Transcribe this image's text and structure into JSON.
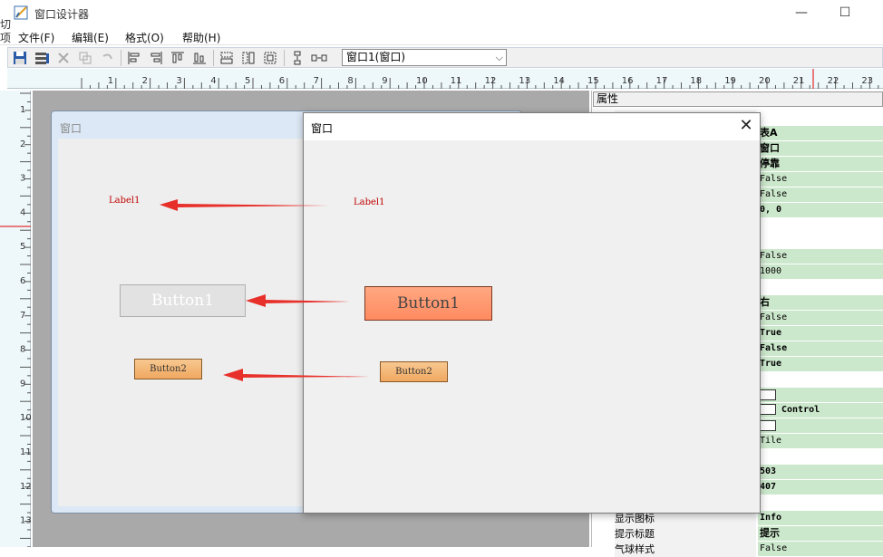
{
  "app": {
    "title": "窗口设计器",
    "icon": "designer-app-icon"
  },
  "window_controls": {
    "minimize": "—",
    "maximize": "☐"
  },
  "menu": [
    {
      "label": "文件(F)"
    },
    {
      "label": "编辑(E)"
    },
    {
      "label": "格式(O)"
    },
    {
      "label": "帮助(H)"
    }
  ],
  "toolbar": {
    "buttons": [
      "save-icon",
      "multi-save-icon",
      "delete-icon",
      "copy-icon",
      "undo-icon",
      "align-left-icon",
      "align-right-icon",
      "align-top-icon",
      "align-bottom-icon",
      "same-width-icon",
      "same-height-icon",
      "same-size-icon",
      "vertical-spacing-icon",
      "horizontal-spacing-icon"
    ],
    "combo_value": "窗口1(窗口)"
  },
  "rulers": {
    "horizontal": [
      "1",
      "2",
      "3",
      "4",
      "5",
      "6",
      "7",
      "8",
      "9",
      "10",
      "11",
      "12",
      "13",
      "14",
      "15",
      "16",
      "17",
      "18",
      "19",
      "20",
      "21",
      "22",
      "23"
    ],
    "vertical": [
      "1",
      "2",
      "3",
      "4",
      "5",
      "6",
      "7",
      "8",
      "9",
      "10",
      "11",
      "12",
      "13"
    ],
    "left_edge_glyphs": [
      "切",
      "项"
    ]
  },
  "design_form": {
    "title": "窗口",
    "label1": "Label1",
    "button1": "Button1",
    "button2": "Button2"
  },
  "preview": {
    "title": "窗口",
    "close": "✕",
    "label1": "Label1",
    "button1": "Button1",
    "button2": "Button2"
  },
  "properties": {
    "header": "属性",
    "rows": [
      {
        "name": "",
        "value": ""
      },
      {
        "name": "",
        "value": "表A"
      },
      {
        "name": "",
        "value": "窗口"
      },
      {
        "name": "",
        "value": "停靠"
      },
      {
        "name": "",
        "value": "False"
      },
      {
        "name": "",
        "value": "False"
      },
      {
        "name": "",
        "value": "0, 0"
      },
      {
        "name": "",
        "value": ""
      },
      {
        "name": "",
        "value": ""
      },
      {
        "name": "",
        "value": "False"
      },
      {
        "name": "",
        "value": "1000"
      },
      {
        "name": "",
        "value": ""
      },
      {
        "name": "",
        "value": "右"
      },
      {
        "name": "",
        "value": "False"
      },
      {
        "name": "",
        "value": "True"
      },
      {
        "name": "",
        "value": "False"
      },
      {
        "name": "",
        "value": "True"
      },
      {
        "name": "",
        "value": ""
      },
      {
        "name": "",
        "value": ""
      },
      {
        "name": "",
        "value": "Control"
      },
      {
        "name": "",
        "value": ""
      },
      {
        "name": "",
        "value": "Tile"
      },
      {
        "name": "",
        "value": ""
      },
      {
        "name": "",
        "value": "503"
      },
      {
        "name": "",
        "value": "407"
      },
      {
        "name": "",
        "value": ""
      },
      {
        "name": "显示图标",
        "value": "Info"
      },
      {
        "name": "提示标题",
        "value": "提示"
      },
      {
        "name": "气球样式",
        "value": "False"
      }
    ]
  },
  "colors": {
    "label_red": "#c00000",
    "arrow_red": "#e8302a",
    "button1_preview": "#ff8a60",
    "button2": "#f0a860",
    "prop_value_bg": "#cce8cc"
  }
}
